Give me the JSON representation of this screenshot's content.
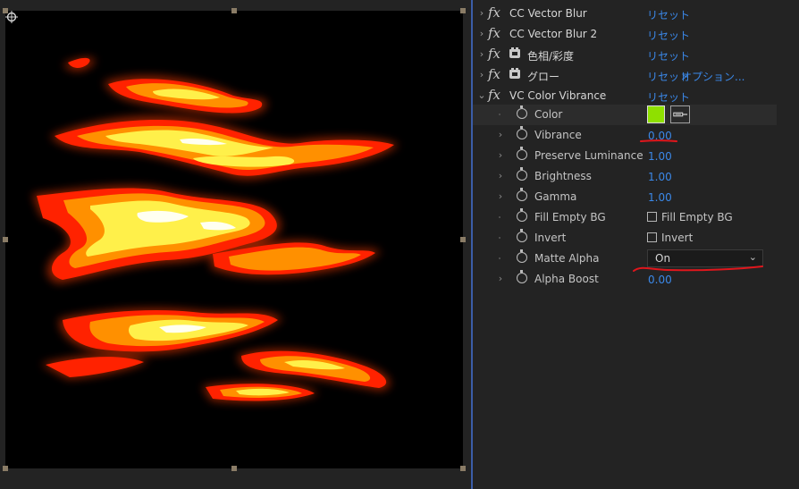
{
  "effects": [
    {
      "name": "CC Vector Blur",
      "reset": "リセット"
    },
    {
      "name": "CC Vector Blur 2",
      "reset": "リセット"
    },
    {
      "name": "色相/彩度",
      "reset": "リセット"
    },
    {
      "name": "グロー",
      "reset": "リセット",
      "options": "オプション..."
    },
    {
      "name": "VC Color Vibrance",
      "reset": "リセット"
    }
  ],
  "fx_glyph": "fx",
  "params": {
    "color": {
      "label": "Color",
      "value": "#8fe000"
    },
    "vibrance": {
      "label": "Vibrance",
      "value": "0.00"
    },
    "preserve_luminance": {
      "label": "Preserve Luminance",
      "value": "1.00"
    },
    "brightness": {
      "label": "Brightness",
      "value": "1.00"
    },
    "gamma": {
      "label": "Gamma",
      "value": "1.00"
    },
    "fill_empty_bg": {
      "label": "Fill Empty BG",
      "checkbox_label": "Fill Empty BG",
      "checked": false
    },
    "invert": {
      "label": "Invert",
      "checkbox_label": "Invert",
      "checked": false
    },
    "matte_alpha": {
      "label": "Matte Alpha",
      "value": "On"
    },
    "alpha_boost": {
      "label": "Alpha Boost",
      "value": "0.00"
    }
  },
  "colors": {
    "link": "#3b88e8",
    "annotation": "#e0161c",
    "lava_outer": "#ff2a00",
    "lava_mid": "#ff9a00",
    "lava_core": "#ffff66"
  }
}
